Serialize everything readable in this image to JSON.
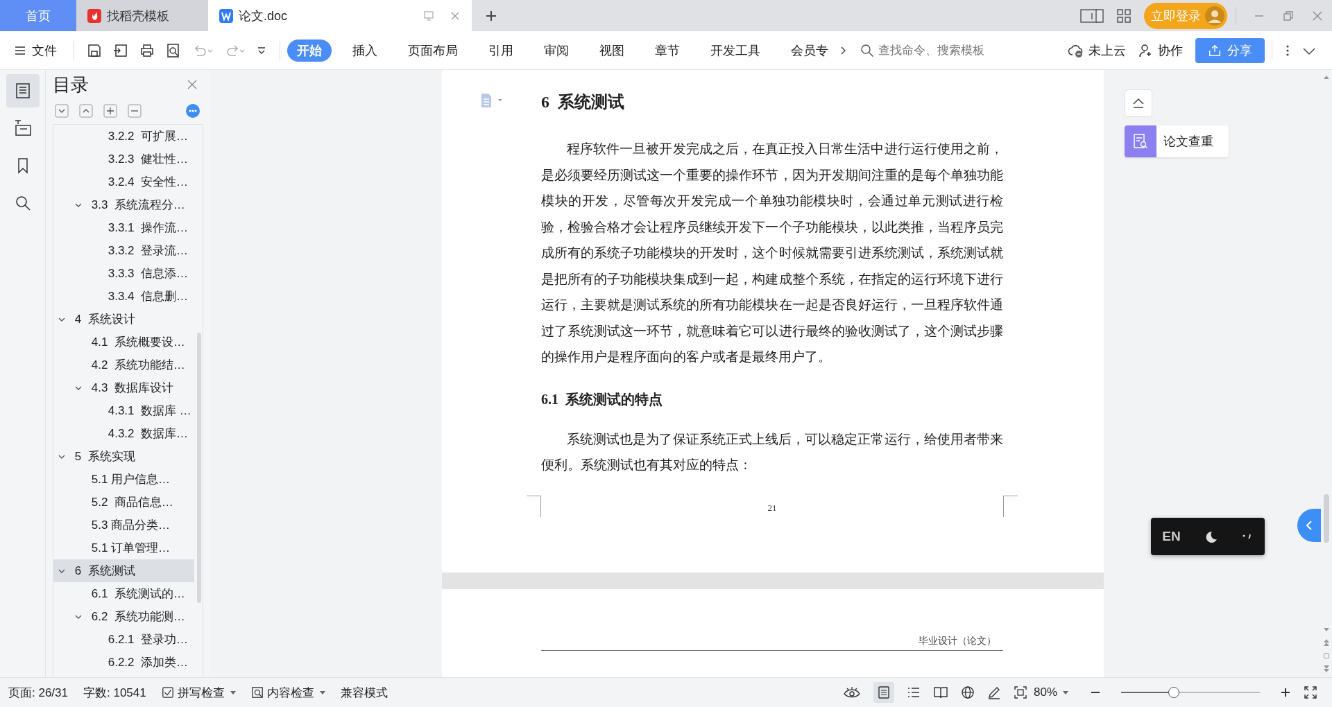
{
  "title_bar": {
    "tabs": [
      {
        "kind": "home",
        "label": "首页",
        "selected": false
      },
      {
        "kind": "docer",
        "label": "找稻壳模板",
        "selected": false
      },
      {
        "kind": "doc",
        "label": "论文.doc",
        "selected": true
      }
    ],
    "login_button": "立即登录"
  },
  "toolbar": {
    "file_menu": "文件",
    "ribbon_tabs": [
      {
        "label": "开始",
        "selected": true
      },
      {
        "label": "插入",
        "selected": false
      },
      {
        "label": "页面布局",
        "selected": false
      },
      {
        "label": "引用",
        "selected": false
      },
      {
        "label": "审阅",
        "selected": false
      },
      {
        "label": "视图",
        "selected": false
      },
      {
        "label": "章节",
        "selected": false
      },
      {
        "label": "开发工具",
        "selected": false
      },
      {
        "label": "会员专",
        "selected": false
      }
    ],
    "search": {
      "placeholder": "查找命令、搜索模板"
    },
    "cloud_status": "未上云",
    "collab": "协作",
    "share": "分享"
  },
  "toc": {
    "title": "目录",
    "items": [
      {
        "children": [
          {
            "children": [
              {
                "label": "3.2.2  可扩展…",
                "selected": false
              },
              {
                "label": "3.2.3  健壮性…",
                "selected": false
              },
              {
                "label": "3.2.4  安全性…",
                "selected": false
              }
            ]
          },
          {
            "label": "3.3  系统流程分…",
            "selected": false,
            "expanded": true,
            "children": [
              {
                "label": "3.3.1  操作流…",
                "selected": false
              },
              {
                "label": "3.3.2  登录流…",
                "selected": false
              },
              {
                "label": "3.3.3  信息添…",
                "selected": false
              },
              {
                "label": "3.3.4  信息删…",
                "selected": false
              }
            ]
          }
        ]
      },
      {
        "label": "4  系统设计",
        "selected": false,
        "expanded": true,
        "children": [
          {
            "label": "4.1  系统概要设…",
            "selected": false
          },
          {
            "label": "4.2  系统功能结…",
            "selected": false
          },
          {
            "label": "4.3  数据库设计",
            "selected": false,
            "expanded": true,
            "children": [
              {
                "label": "4.3.1  数据库 …",
                "selected": false
              },
              {
                "label": "4.3.2  数据库…",
                "selected": false
              }
            ]
          }
        ]
      },
      {
        "label": "5  系统实现",
        "selected": false,
        "expanded": true,
        "children": [
          {
            "label": "5.1 用户信息…",
            "selected": false
          },
          {
            "label": "5.2  商品信息…",
            "selected": false
          },
          {
            "label": "5.3 商品分类…",
            "selected": false
          },
          {
            "label": "5.1 订单管理…",
            "selected": false
          }
        ]
      },
      {
        "label": "6  系统测试",
        "selected": true,
        "expanded": true,
        "children": [
          {
            "label": "6.1  系统测试的…",
            "selected": false
          },
          {
            "label": "6.2  系统功能测…",
            "selected": false,
            "expanded": true,
            "children": [
              {
                "label": "6.2.1  登录功…",
                "selected": false
              },
              {
                "label": "6.2.2  添加类…",
                "selected": false
              }
            ]
          }
        ]
      }
    ]
  },
  "document": {
    "heading": "6  系统测试",
    "paragraph_1": "程序软件一旦被开发完成之后，在真正投入日常生活中进行运行使用之前，是必须要经历测试这一个重要的操作环节，因为开发期间注重的是每个单独功能模块的开发，尽管每次开发完成一个单独功能模块时，会通过单元测试进行检验，检验合格才会让程序员继续开发下一个子功能模块，以此类推，当程序员完成所有的系统子功能模块的开发时，这个时候就需要引进系统测试，系统测试就是把所有的子功能模块集成到一起，构建成整个系统，在指定的运行环境下进行运行，主要就是测试系统的所有功能模块在一起是否良好运行，一旦程序软件通过了系统测试这一环节，就意味着它可以进行最终的验收测试了，这个测试步骤的操作用户是程序面向的客户或者是最终用户了。",
    "subheading": "6.1  系统测试的特点",
    "paragraph_2": "系统测试也是为了保证系统正式上线后，可以稳定正常运行，给使用者带来便利。系统测试也有其对应的特点：",
    "page_number": "21",
    "next_page_header": "毕业设计（论文）"
  },
  "side_panel": {
    "check_button": "论文查重"
  },
  "ime_bar": {
    "language": "EN"
  },
  "status_bar": {
    "page": "页面: 26/31",
    "word_count": "字数: 10541",
    "spell_check": "拼写检查",
    "content_check": "内容检查",
    "compat_mode": "兼容模式",
    "zoom": "80%",
    "zoom_slider": {
      "level": 0.38
    }
  }
}
